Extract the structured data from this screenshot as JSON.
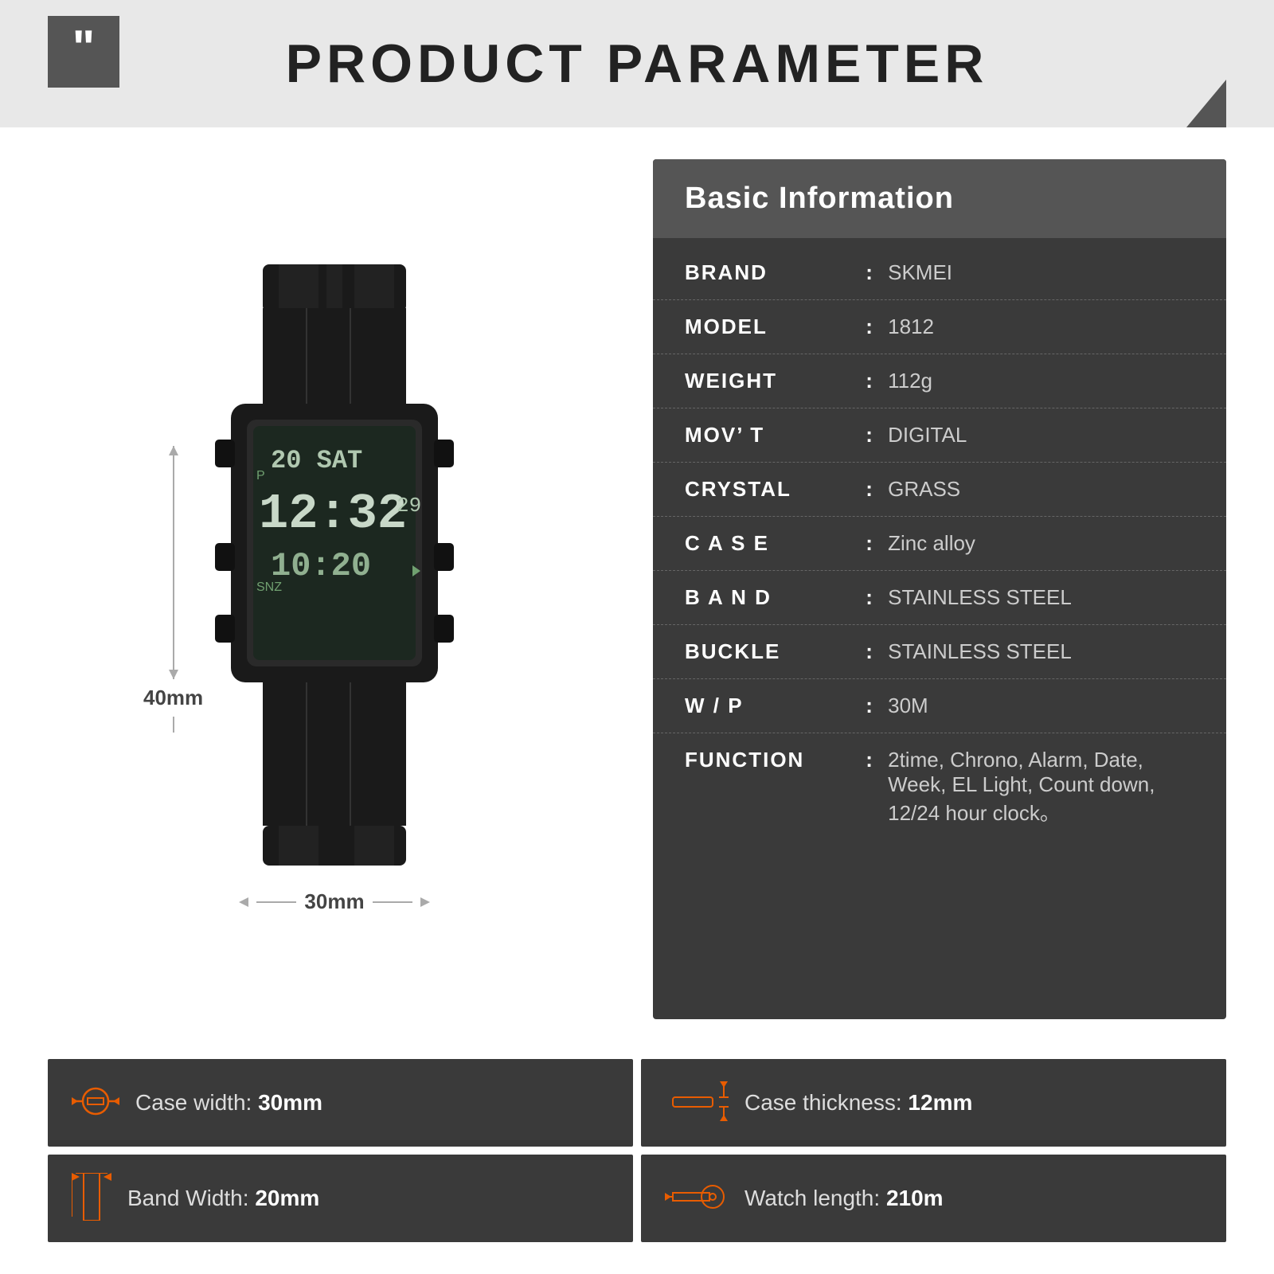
{
  "header": {
    "title": "PRODUCT PARAMETER"
  },
  "info": {
    "section_title": "Basic Information",
    "rows": [
      {
        "key": "BRAND",
        "value": "SKMEI"
      },
      {
        "key": "MODEL",
        "value": "1812"
      },
      {
        "key": "WEIGHT",
        "value": "112g"
      },
      {
        "key": "MOV’ T",
        "value": "DIGITAL"
      },
      {
        "key": "CRYSTAL",
        "value": "GRASS"
      },
      {
        "key": "C A S E",
        "value": "Zinc alloy"
      },
      {
        "key": "B A N D",
        "value": "STAINLESS STEEL"
      },
      {
        "key": "BUCKLE",
        "value": "STAINLESS STEEL"
      },
      {
        "key": "W / P",
        "value": "30M"
      },
      {
        "key": "FUNCTION",
        "value": "2time, Chrono, Alarm, Date, Week, EL Light, Count down, 12/24 hour clock。"
      }
    ]
  },
  "dimensions": {
    "height": "40mm",
    "width": "30mm"
  },
  "specs": [
    {
      "label": "Case width:",
      "value": "30mm",
      "icon": "watch-width-icon"
    },
    {
      "label": "Case thickness:",
      "value": "12mm",
      "icon": "watch-thickness-icon"
    },
    {
      "label": "Band Width:",
      "value": "20mm",
      "icon": "band-width-icon"
    },
    {
      "label": "Watch length:",
      "value": "210m",
      "icon": "watch-length-icon"
    }
  ]
}
